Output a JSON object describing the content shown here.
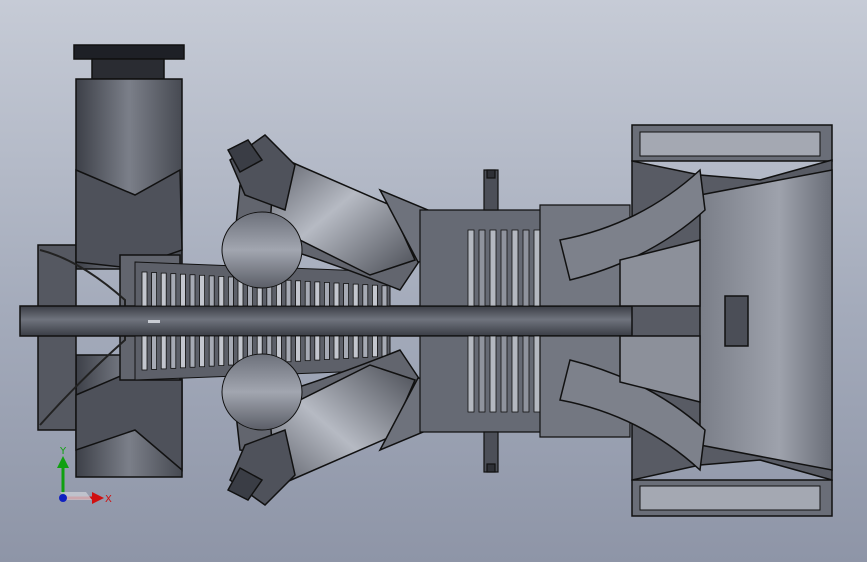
{
  "triad": {
    "x_label": "X",
    "y_label": "Y",
    "x_color": "#d01010",
    "y_color": "#10a010",
    "z_color": "#1020c0"
  },
  "colors": {
    "section_fill": "#5a5d66",
    "section_light": "#8a8e98",
    "section_dark": "#3c3f46",
    "edge": "#111111",
    "shaft": "#4b4e57"
  }
}
